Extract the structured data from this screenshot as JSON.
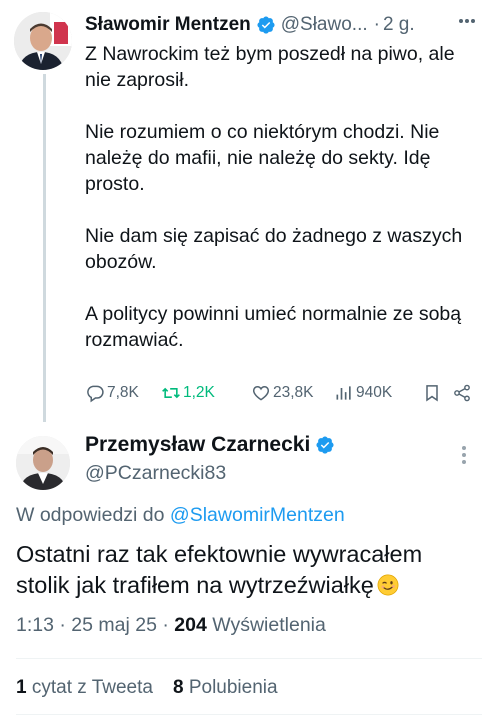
{
  "thread": {
    "tweet1": {
      "author_name": "Sławomir Mentzen",
      "author_handle": "@Sławo...",
      "separator": "·",
      "time": "2 g.",
      "paragraphs": [
        "Z Nawrockim też bym poszedł na piwo, ale nie zaprosił.",
        "Nie rozumiem o co niektórym chodzi. Nie należę do mafii, nie należę do sekty. Idę prosto.",
        "Nie dam się zapisać do żadnego z waszych obozów.",
        "A politycy powinni umieć normalnie ze sobą rozmawiać."
      ],
      "actions": {
        "replies": "7,8K",
        "retweets": "1,2K",
        "likes": "23,8K",
        "views": "940K"
      }
    },
    "tweet2": {
      "author_name": "Przemysław Czarnecki",
      "author_handle": "@PCzarnecki83",
      "reply_prefix": "W odpowiedzi do",
      "reply_mention": "@SlawomirMentzen",
      "text": "Ostatni raz tak efektownie wywracałem stolik jak trafiłem na wytrzeźwiałkę",
      "time": "1:13 · 25 maj 25 ·",
      "views_count": "204",
      "views_label": "Wyświetlenia",
      "quotes_count": "1",
      "quotes_label": "cytat z Tweeta",
      "likes_count": "8",
      "likes_label": "Polubienia"
    }
  },
  "colors": {
    "accent": "#1d9bf0",
    "retweet": "#00ba7c",
    "secondary_text": "#536471",
    "primary_text": "#0f1419"
  },
  "icons": [
    "verified-badge-icon",
    "more-icon",
    "reply-icon",
    "retweet-icon",
    "like-icon",
    "views-icon",
    "bookmark-icon",
    "share-icon",
    "winking-face-emoji"
  ]
}
